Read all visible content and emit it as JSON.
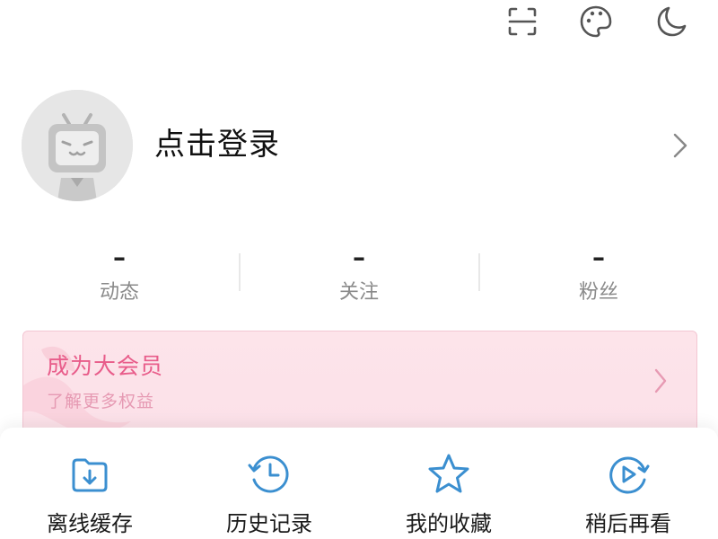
{
  "toolbar": {
    "icons": [
      "scan-icon",
      "palette-icon",
      "moon-icon"
    ]
  },
  "profile": {
    "login_label": "点击登录"
  },
  "stats": [
    {
      "value": "–",
      "label": "动态"
    },
    {
      "value": "–",
      "label": "关注"
    },
    {
      "value": "–",
      "label": "粉丝"
    }
  ],
  "vip": {
    "title": "成为大会员",
    "subtitle": "了解更多权益"
  },
  "actions": [
    {
      "label": "离线缓存",
      "icon": "download-folder-icon"
    },
    {
      "label": "历史记录",
      "icon": "history-clock-icon"
    },
    {
      "label": "我的收藏",
      "icon": "star-icon"
    },
    {
      "label": "稍后再看",
      "icon": "watch-later-icon"
    }
  ],
  "colors": {
    "accent_blue": "#3b8fd0",
    "vip_pink": "#e85c8a",
    "vip_bg": "#fde4ea"
  }
}
